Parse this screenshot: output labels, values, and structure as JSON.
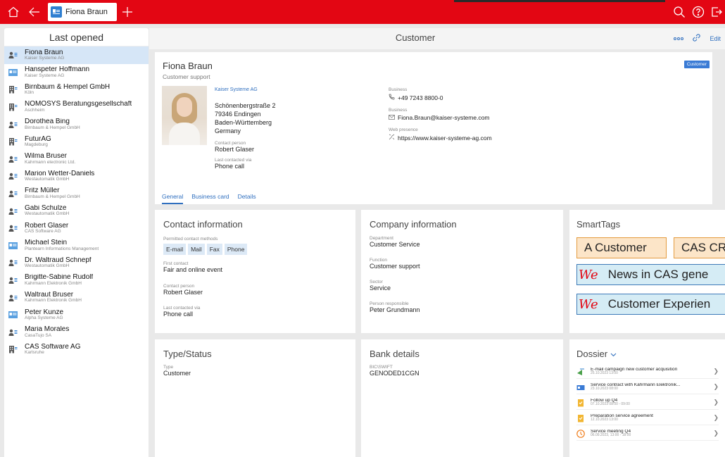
{
  "topbar": {
    "tab_label": "Fiona Braun",
    "icons": [
      "home-icon",
      "back-arrow-icon",
      "plus-icon",
      "search-icon",
      "help-icon",
      "logout-icon"
    ]
  },
  "left": {
    "title": "Last opened",
    "items": [
      {
        "name": "Fiona Braun",
        "sub": "Kaiser Systeme AG",
        "icon": "person"
      },
      {
        "name": "Hanspeter Hoffmann",
        "sub": "Kaiser Systeme AG",
        "icon": "card"
      },
      {
        "name": "Birnbaum & Hempel GmbH",
        "sub": "Köln",
        "icon": "company"
      },
      {
        "name": "NOMOSYS Beratungsgesellschaft",
        "sub": "Aschheim",
        "icon": "company"
      },
      {
        "name": "Dorothea Bing",
        "sub": "Birnbaum & Hempel GmbH",
        "icon": "person"
      },
      {
        "name": "FuturAG",
        "sub": "Magdeburg",
        "icon": "company"
      },
      {
        "name": "Wilma Bruser",
        "sub": "Kahrmann electronic Ltd.",
        "icon": "person"
      },
      {
        "name": "Marion Wetter-Daniels",
        "sub": "Westautomatik GmbH",
        "icon": "person"
      },
      {
        "name": "Fritz Müller",
        "sub": "Birnbaum & Hempel GmbH",
        "icon": "person"
      },
      {
        "name": "Gabi Schulze",
        "sub": "Westautomatik GmbH",
        "icon": "person"
      },
      {
        "name": "Robert Glaser",
        "sub": "CAS Software AG",
        "icon": "person"
      },
      {
        "name": "Michael Stein",
        "sub": "Plantearn Informations Management",
        "icon": "card"
      },
      {
        "name": "Dr. Waltraud Schnepf",
        "sub": "Westautomatik GmbH",
        "icon": "person"
      },
      {
        "name": "Brigitte-Sabine Rudolf",
        "sub": "Kahrmann Elektronik GmbH",
        "icon": "person"
      },
      {
        "name": "Waltraut Bruser",
        "sub": "Kahrmann Elektronik GmbH",
        "icon": "person"
      },
      {
        "name": "Peter Kunze",
        "sub": "Alpha Systeme AG",
        "icon": "card"
      },
      {
        "name": "Maria Morales",
        "sub": "CasaTujo SA",
        "icon": "person"
      },
      {
        "name": "CAS Software AG",
        "sub": "Karlsruhe",
        "icon": "company"
      }
    ]
  },
  "header": {
    "title": "Customer",
    "more_icon": "more-icon",
    "link_icon": "link-icon",
    "edit_label": "Edit"
  },
  "hero": {
    "name": "Fiona Braun",
    "role": "Customer support",
    "badge": "Customer",
    "company": "Kaiser Systeme AG",
    "address": [
      "Schönenbergstraße 2",
      "79346 Endingen",
      "Baden-Württemberg",
      "Germany"
    ],
    "contact_person_label": "Contact person",
    "contact_person": "Robert Glaser",
    "last_contacted_label": "Last contacted via",
    "last_contacted": "Phone call",
    "phone_label": "Business",
    "phone": "+49 7243 8800-0",
    "email_label": "Business",
    "email": "Fiona.Braun@kaiser-systeme.com",
    "web_label": "Web presence",
    "web": "https://www.kaiser-systeme-ag.com",
    "tabs": [
      "General",
      "Business card",
      "Details"
    ]
  },
  "contact_info": {
    "title": "Contact information",
    "methods_label": "Permitted contact methods",
    "methods": [
      "E-mail",
      "Mail",
      "Fax",
      "Phone"
    ],
    "first_contact_label": "First contact",
    "first_contact": "Fair and online event",
    "contact_person_label": "Contact person",
    "contact_person": "Robert Glaser",
    "last_contacted_label": "Last contacted via",
    "last_contacted": "Phone call"
  },
  "company_info": {
    "title": "Company information",
    "department_label": "Department",
    "department": "Customer Service",
    "function_label": "Function",
    "function": "Customer support",
    "sector_label": "Sector",
    "sector": "Service",
    "responsible_label": "Person responsible",
    "responsible": "Peter Grundmann"
  },
  "smarttags": {
    "title": "SmartTags",
    "tag1": "A Customer",
    "tag2": "CAS CR",
    "we_mark": "We",
    "tag3": "News in CAS gene",
    "tag4": "Customer Experien"
  },
  "type_status": {
    "title": "Type/Status",
    "type_label": "Type",
    "type": "Customer"
  },
  "bank": {
    "title": "Bank details",
    "bic_label": "BIC\\SWIFT",
    "bic": "GENODED1CGN"
  },
  "dossier": {
    "title": "Dossier",
    "items": [
      {
        "title": "E-mail campaign new customer acquisition",
        "date": "25.10.2023 13:00",
        "icon": "campaign"
      },
      {
        "title": "Service contract with Kahrmann Elektronik...",
        "date": "23.10.2023 08:00",
        "icon": "contract"
      },
      {
        "title": "Follow up Q4",
        "date": "07.10.2023 08:00 - 09:00",
        "icon": "task"
      },
      {
        "title": "Preparation service agreement",
        "date": "12.10.2023 13:00",
        "icon": "task"
      },
      {
        "title": "Service meeting Q4",
        "date": "06.09.2023, 13:00 - 18:00",
        "icon": "meeting"
      }
    ]
  },
  "colors": {
    "brand": "#e30613",
    "link": "#2f6fbf",
    "selection": "#d6e6f7"
  }
}
